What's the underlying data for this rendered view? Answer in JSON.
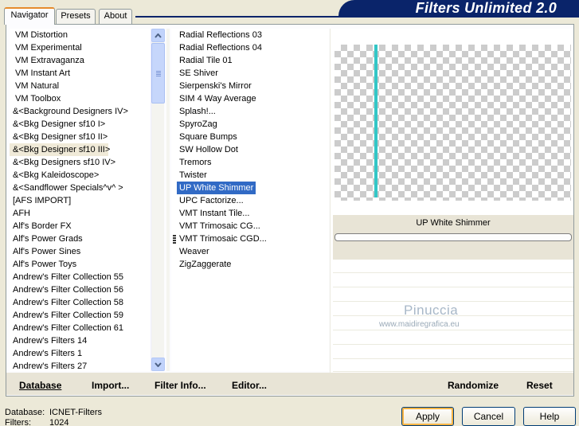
{
  "window": {
    "title": "Filters Unlimited 2.0"
  },
  "tabs": [
    {
      "label": "Navigator"
    },
    {
      "label": "Presets"
    },
    {
      "label": "About"
    }
  ],
  "categories": [
    "VM Distortion",
    "VM Experimental",
    "VM Extravaganza",
    "VM Instant Art",
    "VM Natural",
    "VM Toolbox",
    "&<Background Designers IV>",
    "&<Bkg Designer sf10 I>",
    "&<Bkg Designer sf10 II>",
    "&<Bkg Designer sf10 III>",
    "&<Bkg Designers sf10 IV>",
    "&<Bkg Kaleidoscope>",
    "&<Sandflower Specials^v^ >",
    "[AFS IMPORT]",
    "AFH",
    "Alf's Border FX",
    "Alf's Power Grads",
    "Alf's Power Sines",
    "Alf's Power Toys",
    "Andrew's Filter Collection 55",
    "Andrew's Filter Collection 56",
    "Andrew's Filter Collection 58",
    "Andrew's Filter Collection 59",
    "Andrew's Filter Collection 61",
    "Andrew's Filters 14",
    "Andrew's Filters 1",
    "Andrew's Filters 27"
  ],
  "filters": [
    "Radial Reflections 03",
    "Radial Reflections 04",
    "Radial Tile 01",
    "SE Shiver",
    "Sierpenski's Mirror",
    "SIM 4 Way Average",
    "Splash!...",
    "SpyroZag",
    "Square Bumps",
    "SW Hollow Dot",
    "Tremors",
    "Twister",
    "UP White Shimmer",
    "UPC Factorize...",
    "VMT Instant Tile...",
    "VMT Trimosaic CG...",
    "VMT Trimosaic CGD...",
    "Weaver",
    "ZigZaggerate"
  ],
  "selected_category_index": 9,
  "selected_filter_index": 12,
  "preview": {
    "filter_name": "UP White Shimmer"
  },
  "watermark": {
    "name": "Pinuccia",
    "url": "www.maidiregrafica.eu"
  },
  "bottom_links": {
    "database": "Database",
    "import": "Import...",
    "filter_info": "Filter Info...",
    "editor": "Editor...",
    "randomize": "Randomize",
    "reset": "Reset"
  },
  "status": {
    "database_label": "Database:",
    "database_value": "ICNET-Filters",
    "filters_label": "Filters:",
    "filters_value": "1024"
  },
  "buttons": {
    "apply": "Apply",
    "cancel": "Cancel",
    "help": "Help"
  },
  "colors": {
    "selection": "#316ac5",
    "banner": "#0a246a",
    "accent_line": "#33c6c6"
  }
}
